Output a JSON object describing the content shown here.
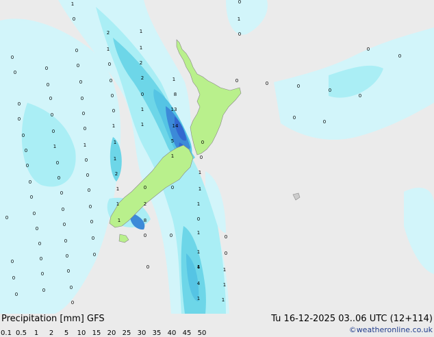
{
  "map": {
    "point_labels": [
      "0",
      "1",
      "2",
      "4",
      "8",
      "13",
      "14",
      "5"
    ]
  },
  "footer": {
    "title": "Precipitation [mm]  GFS",
    "datetime": "Tu 16-12-2025 03..06 UTC (12+114)",
    "credit": "©weatheronline.co.uk"
  },
  "legend": {
    "ticks": [
      "0.1",
      "0.5",
      "1",
      "2",
      "5",
      "10",
      "15",
      "20",
      "25",
      "30",
      "35",
      "40",
      "45",
      "50"
    ],
    "colors": [
      "#d2f5fa",
      "#aaeef5",
      "#8ae2ee",
      "#6dd6e8",
      "#55c4e4",
      "#48a8e0",
      "#3c8ad8",
      "#3268d0",
      "#2a46c2",
      "#8c18c8",
      "#aa1ad0",
      "#c81cd8",
      "#e01ee0",
      "#f020e8"
    ]
  },
  "colors": {
    "land": "#b9f08c",
    "sea": "#ebebeb",
    "coast": "#888888"
  }
}
